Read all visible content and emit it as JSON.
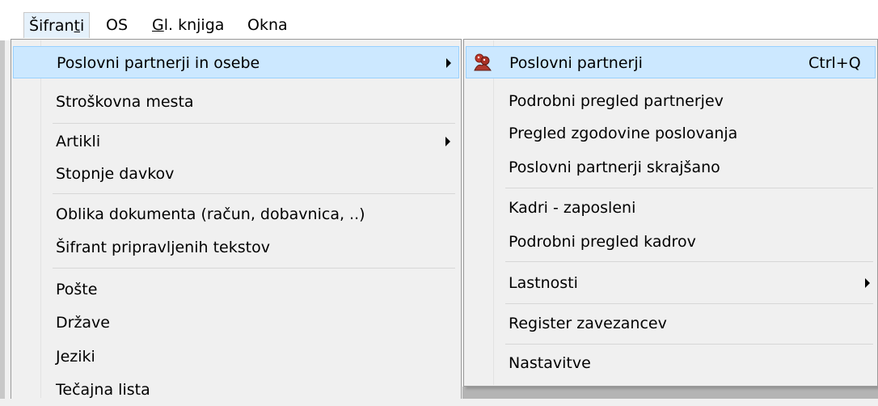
{
  "menubar": {
    "items": [
      {
        "pre": "Šifran",
        "ul": "t",
        "post": "i"
      },
      {
        "pre": "",
        "ul": "",
        "post": "OS"
      },
      {
        "pre": "",
        "ul": "G",
        "post": "l. knjiga"
      },
      {
        "pre": "",
        "ul": "",
        "post": "Okna"
      }
    ]
  },
  "menu1": {
    "items": [
      "Poslovni partnerji in osebe",
      "Stroškovna mesta",
      "Artikli",
      "Stopnje davkov",
      "Oblika dokumenta (račun, dobavnica, ..)",
      "Šifrant pripravljenih tekstov",
      "Pošte",
      "Države",
      "Jeziki",
      "Tečajna lista"
    ]
  },
  "menu2": {
    "items": [
      "Poslovni partnerji",
      "Podrobni pregled partnerjev",
      "Pregled zgodovine poslovanja",
      "Poslovni partnerji skrajšano",
      "Kadri - zaposleni",
      "Podrobni pregled kadrov",
      "Lastnosti",
      "Register zavezancev",
      "Nastavitve"
    ],
    "shortcut": "Ctrl+Q"
  },
  "icons": {
    "partners": "partners-icon"
  }
}
